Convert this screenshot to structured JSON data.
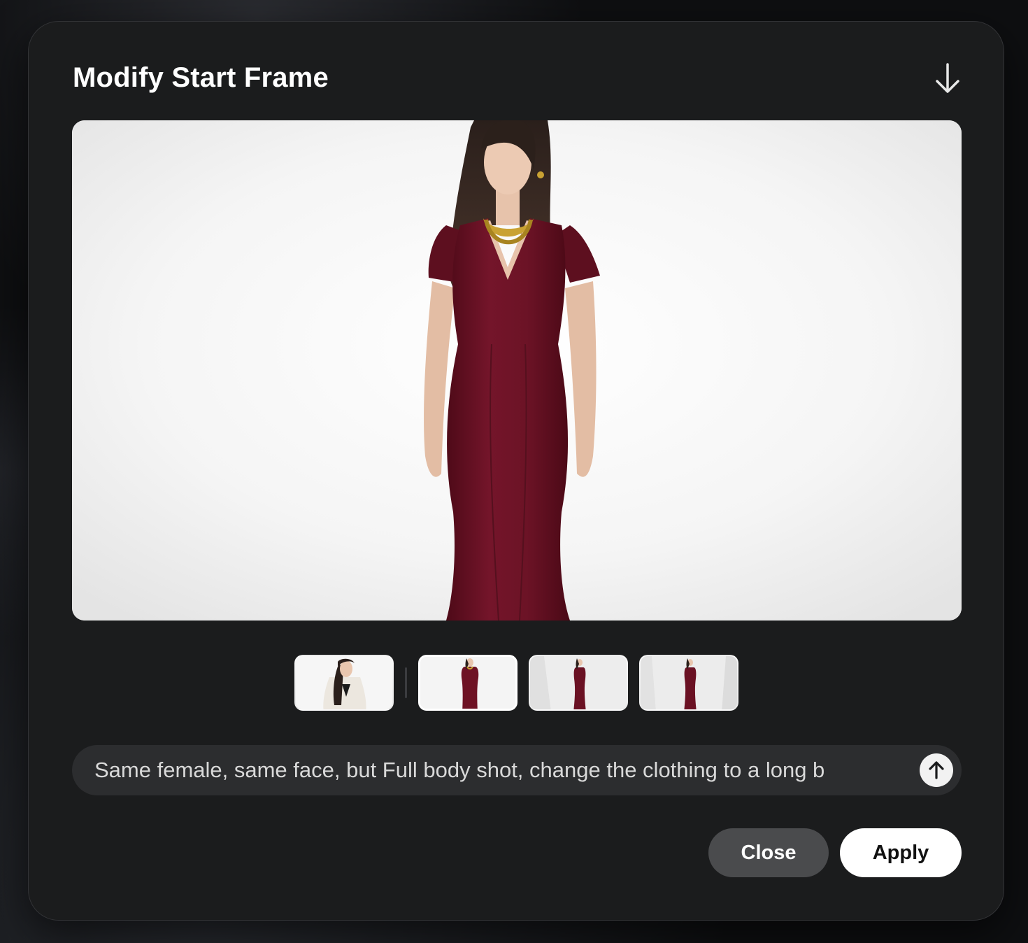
{
  "dialog": {
    "title": "Modify Start Frame",
    "download_icon": "arrow-down-icon"
  },
  "preview": {
    "subject": "Woman in long burgundy short-sleeve dress with gold necklace on white background"
  },
  "thumbnails": [
    {
      "label": "Woman in cream coat",
      "selected": false
    },
    {
      "label": "Woman in burgundy dress, close",
      "selected": true
    },
    {
      "label": "Woman in burgundy dress, full body",
      "selected": false
    },
    {
      "label": "Woman in burgundy dress, full body, wide",
      "selected": false
    }
  ],
  "prompt": {
    "value": "Same female, same face, but Full body shot, change the clothing to a long b",
    "send_icon": "arrow-up-icon"
  },
  "actions": {
    "close_label": "Close",
    "apply_label": "Apply"
  },
  "colors": {
    "dialog_bg": "#1b1c1d",
    "dress": "#6e1224",
    "necklace": "#c9a233"
  }
}
